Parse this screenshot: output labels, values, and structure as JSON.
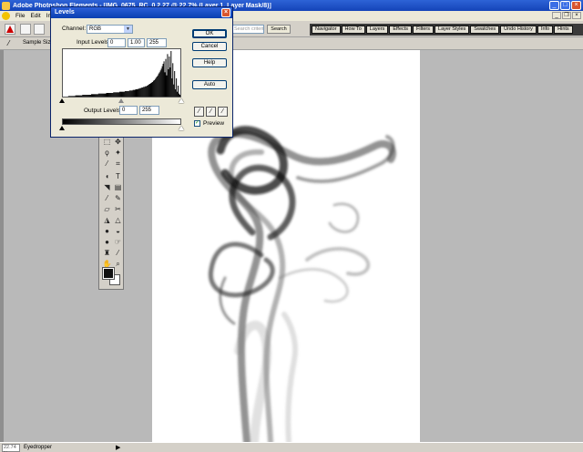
{
  "window": {
    "title": "Adobe Photoshop Elements - [IMG_0675_RC_0.2.27 @ 22.7% (Layer 1, Layer Mask/8)]",
    "minimize": "_",
    "maximize": "□",
    "close": "×"
  },
  "menu": {
    "items": [
      "File",
      "Edit",
      "Image"
    ],
    "doc_min": "_",
    "doc_restore": "❐",
    "doc_close": "×"
  },
  "shortcuts": {
    "search_placeholder": "Search criteria",
    "search_button": "Search"
  },
  "palette_well": {
    "tabs": [
      "Navigator",
      "How To",
      "Layers",
      "Effects",
      "Filters",
      "Layer Styles",
      "Swatches",
      "Undo History",
      "Info",
      "Hints"
    ]
  },
  "options_bar": {
    "sample_size_label": "Sample Size:"
  },
  "levels_dialog": {
    "title": "Levels",
    "close": "×",
    "channel_label": "Channel:",
    "channel_value": "RGB",
    "channel_arrow": "▼",
    "input_levels_label": "Input Levels:",
    "input_black": "0",
    "input_gamma": "1.00",
    "input_white": "255",
    "output_levels_label": "Output Levels:",
    "output_black": "0",
    "output_white": "255",
    "ok": "OK",
    "cancel": "Cancel",
    "help": "Help",
    "auto": "Auto",
    "preview_label": "Preview",
    "preview_checked": "✓",
    "histogram": [
      0,
      0,
      0,
      0,
      0,
      0,
      1,
      1,
      1,
      1,
      1,
      1,
      1,
      1,
      2,
      2,
      2,
      2,
      2,
      2,
      2,
      2,
      3,
      3,
      3,
      3,
      3,
      3,
      3,
      3,
      3,
      3,
      4,
      4,
      4,
      4,
      4,
      4,
      4,
      4,
      5,
      5,
      5,
      5,
      5,
      5,
      5,
      5,
      5,
      6,
      6,
      6,
      6,
      6,
      6,
      6,
      6,
      7,
      7,
      7,
      7,
      7,
      7,
      7,
      8,
      8,
      8,
      8,
      8,
      8,
      9,
      9,
      9,
      9,
      9,
      10,
      10,
      10,
      10,
      11,
      11,
      11,
      12,
      12,
      12,
      13,
      13,
      14,
      14,
      15,
      15,
      16,
      16,
      17,
      17,
      18,
      19,
      20,
      21,
      22,
      23,
      24,
      26,
      27,
      29,
      31,
      33,
      35,
      38,
      40,
      43,
      46,
      50,
      54,
      58,
      40,
      62,
      35,
      70,
      45,
      66,
      48,
      75,
      30,
      55,
      20,
      42,
      12,
      30,
      8,
      18,
      5,
      3
    ]
  },
  "status": {
    "zoom": "22.74 %",
    "tool": "Eyedropper",
    "arrow": "▶"
  }
}
